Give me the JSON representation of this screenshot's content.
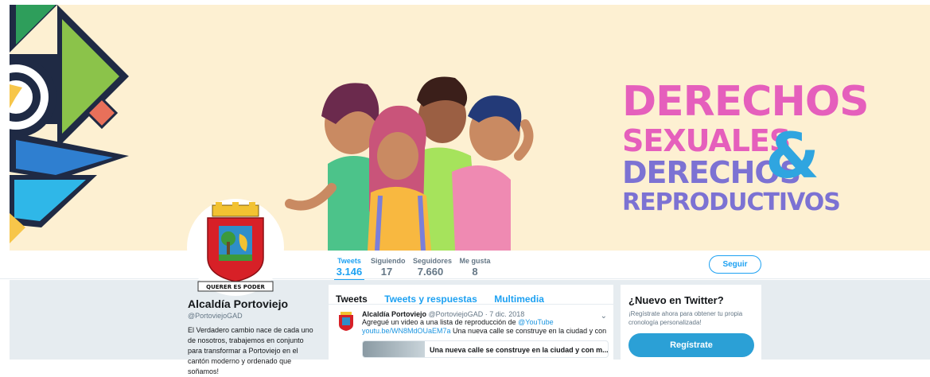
{
  "banner": {
    "slogan": {
      "line1": "DERECHOS",
      "line2": "SEXUALES",
      "line3": "DERECHOS",
      "line4": "REPRODUCTIVOS",
      "amp": "&"
    },
    "palette": {
      "background": "#fdf0d2",
      "pink": "#e55fbc",
      "purple": "#7c72d3",
      "blue": "#2fa5e0"
    }
  },
  "avatar": {
    "motto_left": "QUERER",
    "motto_mid": "ES",
    "motto_right": "PODER"
  },
  "stats": [
    {
      "label": "Tweets",
      "value": "3.146"
    },
    {
      "label": "Siguiendo",
      "value": "17"
    },
    {
      "label": "Seguidores",
      "value": "7.660"
    },
    {
      "label": "Me gusta",
      "value": "8"
    }
  ],
  "follow_label": "Seguir",
  "profile": {
    "name": "Alcaldía Portoviejo",
    "handle": "@PortoviejoGAD",
    "bio": "El Verdadero cambio nace de cada uno de nosotros, trabajemos en conjunto para transformar a Portoviejo en el cantón moderno y ordenado que soñamos!"
  },
  "tabs": [
    "Tweets",
    "Tweets y respuestas",
    "Multimedia"
  ],
  "tweet": {
    "name": "Alcaldía Portoviejo",
    "handle": "@PortoviejoGAD",
    "date": "· 7 dic. 2018",
    "text_prefix": "Agregué un video a una lista de reproducción de ",
    "mention": "@YouTube",
    "link": "youtu.be/WN8MdOUaEM7a",
    "text_suffix": " Una nueva calle se construye en la ciudad y con",
    "card_title": "Una nueva calle se construye en la ciudad y con m..."
  },
  "signup": {
    "title": "¿Nuevo en Twitter?",
    "text": "¡Regístrate ahora para obtener tu propia cronología personalizada!",
    "button": "Regístrate"
  }
}
